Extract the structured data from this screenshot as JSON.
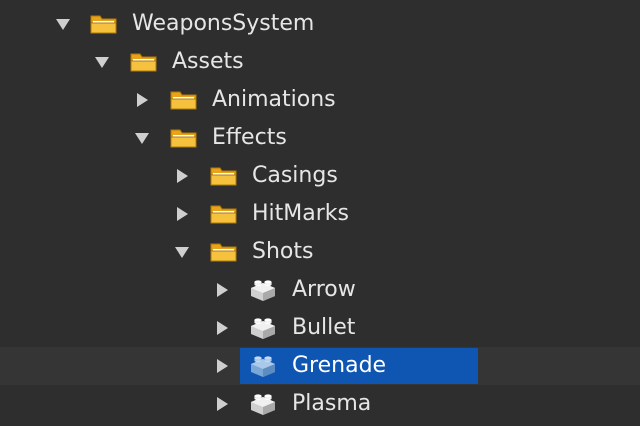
{
  "explorer": {
    "selected_color": "#0f56b3",
    "items": [
      {
        "label": "WeaponsSystem",
        "icon": "folder-icon",
        "expanded": true
      },
      {
        "label": "Assets",
        "icon": "folder-icon",
        "expanded": true
      },
      {
        "label": "Animations",
        "icon": "folder-icon",
        "expanded": false
      },
      {
        "label": "Effects",
        "icon": "folder-icon",
        "expanded": true
      },
      {
        "label": "Casings",
        "icon": "folder-icon",
        "expanded": false
      },
      {
        "label": "HitMarks",
        "icon": "folder-icon",
        "expanded": false
      },
      {
        "label": "Shots",
        "icon": "folder-icon",
        "expanded": true
      },
      {
        "label": "Arrow",
        "icon": "part-brick-icon",
        "expanded": false
      },
      {
        "label": "Bullet",
        "icon": "part-brick-icon",
        "expanded": false
      },
      {
        "label": "Grenade",
        "icon": "part-brick-icon",
        "expanded": false,
        "selected": true
      },
      {
        "label": "Plasma",
        "icon": "part-brick-icon",
        "expanded": false
      }
    ]
  }
}
